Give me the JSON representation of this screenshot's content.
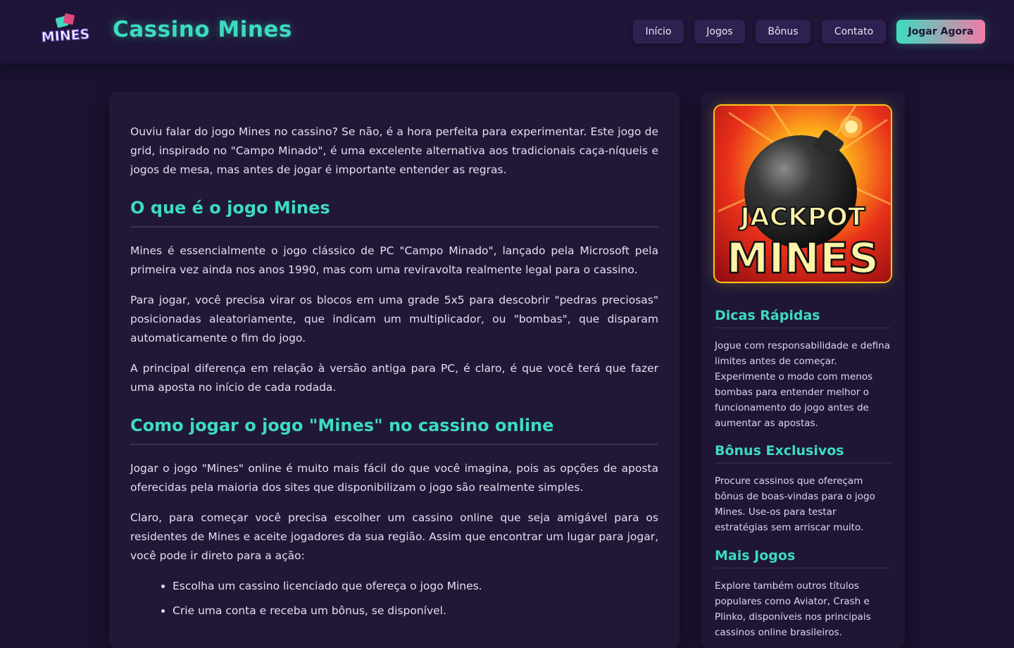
{
  "header": {
    "logo_text": "MINES",
    "site_title": "Cassino Mines",
    "nav": [
      "Início",
      "Jogos",
      "Bônus",
      "Contato"
    ],
    "cta": "Jogar Agora"
  },
  "main": {
    "intro": "Ouviu falar do jogo Mines no cassino? Se não, é a hora perfeita para experimentar. Este jogo de grid, inspirado no \"Campo Minado\", é uma excelente alternativa aos tradicionais caça-níqueis e jogos de mesa, mas antes de jogar é importante entender as regras.",
    "section1": {
      "heading": "O que é o jogo Mines",
      "paragraphs": [
        "Mines é essencialmente o jogo clássico de PC \"Campo Minado\", lançado pela Microsoft pela primeira vez ainda nos anos 1990, mas com uma reviravolta realmente legal para o cassino.",
        "Para jogar, você precisa virar os blocos em uma grade 5x5 para descobrir \"pedras preciosas\" posicionadas aleatoriamente, que indicam um multiplicador, ou \"bombas\", que disparam automaticamente o fim do jogo.",
        "A principal diferença em relação à versão antiga para PC, é claro, é que você terá que fazer uma aposta no início de cada rodada."
      ]
    },
    "section2": {
      "heading": "Como jogar o jogo \"Mines\" no cassino online",
      "paragraphs": [
        "Jogar o jogo \"Mines\" online é muito mais fácil do que você imagina, pois as opções de aposta oferecidas pela maioria dos sites que disponibilizam o jogo são realmente simples.",
        "Claro, para começar você precisa escolher um cassino online que seja amigável para os residentes de Mines e aceite jogadores da sua região. Assim que encontrar um lugar para jogar, você pode ir direto para a ação:"
      ],
      "steps": [
        "Escolha um cassino licenciado que ofereça o jogo Mines.",
        "Crie uma conta e receba um bônus, se disponível."
      ]
    }
  },
  "sidebar": {
    "image_line1": "JACKPOT",
    "image_line2": "MINES",
    "sections": [
      {
        "title": "Dicas Rápidas",
        "text": "Jogue com responsabilidade e defina limites antes de começar. Experimente o modo com menos bombas para entender melhor o funcionamento do jogo antes de aumentar as apostas."
      },
      {
        "title": "Bônus Exclusivos",
        "text": "Procure cassinos que ofereçam bônus de boas-vindas para o jogo Mines. Use-os para testar estratégias sem arriscar muito."
      },
      {
        "title": "Mais Jogos",
        "text": "Explore também outros títulos populares como Aviator, Crash e Plinko, disponíveis nos principais cassinos online brasileiros."
      }
    ]
  },
  "colors": {
    "accent": "#3ddbc0",
    "cta_gradient_end": "#f27aa6",
    "background": "#1a1230",
    "panel": "#211838"
  }
}
